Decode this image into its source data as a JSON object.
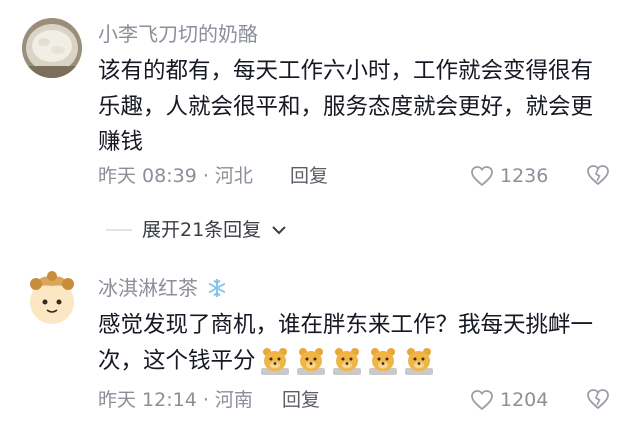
{
  "comments": [
    {
      "username": "小李飞刀切的奶酪",
      "text": "该有的都有，每天工作六小时，工作就会变得很有乐趣，人就会很平和，服务态度就会更好，就会更赚钱",
      "meta": "昨天 08:39 · 河北",
      "reply_label": "回复",
      "likes": "1236",
      "avatar_icon": "food-photo-icon"
    },
    {
      "username": "冰淇淋红茶",
      "username_badge_icon": "snowflake-icon",
      "text": "感觉发现了商机，谁在胖东来工作？我每天挑衅一次，这个钱平分",
      "emoji_icons": [
        "bear-emoji-icon",
        "bear-emoji-icon",
        "bear-emoji-icon",
        "bear-emoji-icon",
        "bear-emoji-icon"
      ],
      "meta": "昨天 12:14 · 河南",
      "reply_label": "回复",
      "likes": "1204",
      "avatar_icon": "cartoon-character-icon"
    }
  ],
  "expand_replies": {
    "label": "展开21条回复"
  },
  "colors": {
    "text": "#161823",
    "muted": "#8a8f99",
    "background": "#ffffff"
  }
}
